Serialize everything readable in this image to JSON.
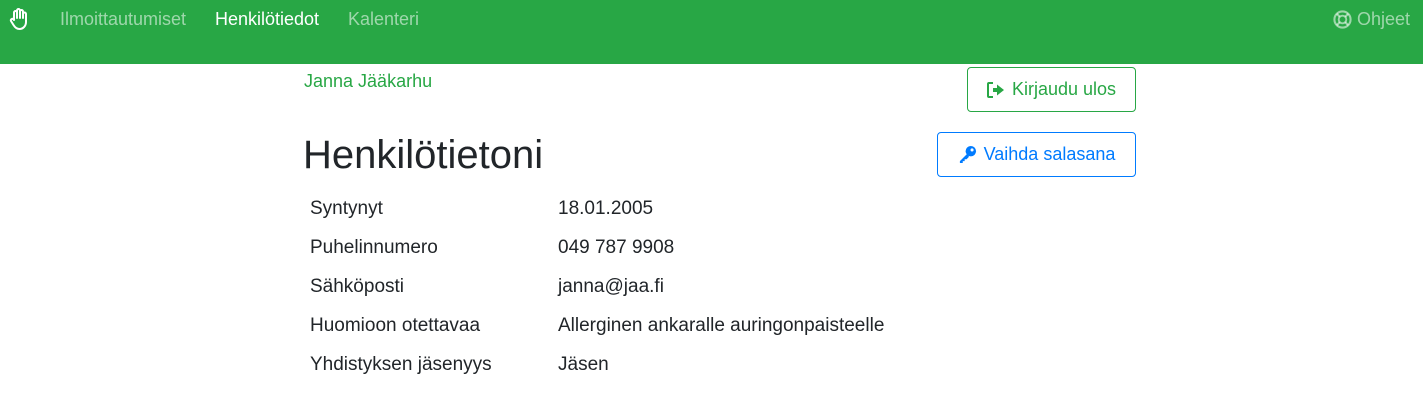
{
  "nav": {
    "brand_icon": "hand-icon",
    "links": [
      {
        "label": "Ilmoittautumiset",
        "active": false
      },
      {
        "label": "Henkilötiedot",
        "active": true
      },
      {
        "label": "Kalenteri",
        "active": false
      }
    ],
    "help": {
      "label": "Ohjeet",
      "icon": "lifebuoy-icon"
    }
  },
  "user": {
    "name": "Janna Jääkarhu"
  },
  "actions": {
    "logout": {
      "label": "Kirjaudu ulos",
      "icon": "sign-out-icon"
    },
    "change_password": {
      "label": "Vaihda salasana",
      "icon": "key-icon"
    }
  },
  "page": {
    "title": "Henkilötietoni"
  },
  "details": [
    {
      "label": "Syntynyt",
      "value": "18.01.2005"
    },
    {
      "label": "Puhelinnumero",
      "value": "049 787 9908"
    },
    {
      "label": "Sähköposti",
      "value": "janna@jaa.fi"
    },
    {
      "label": "Huomioon otettavaa",
      "value": "Allerginen ankaralle auringonpaisteelle"
    },
    {
      "label": "Yhdistyksen jäsenyys",
      "value": "Jäsen"
    }
  ],
  "colors": {
    "brand": "#28a745",
    "primary": "#007bff",
    "text": "#212529"
  }
}
